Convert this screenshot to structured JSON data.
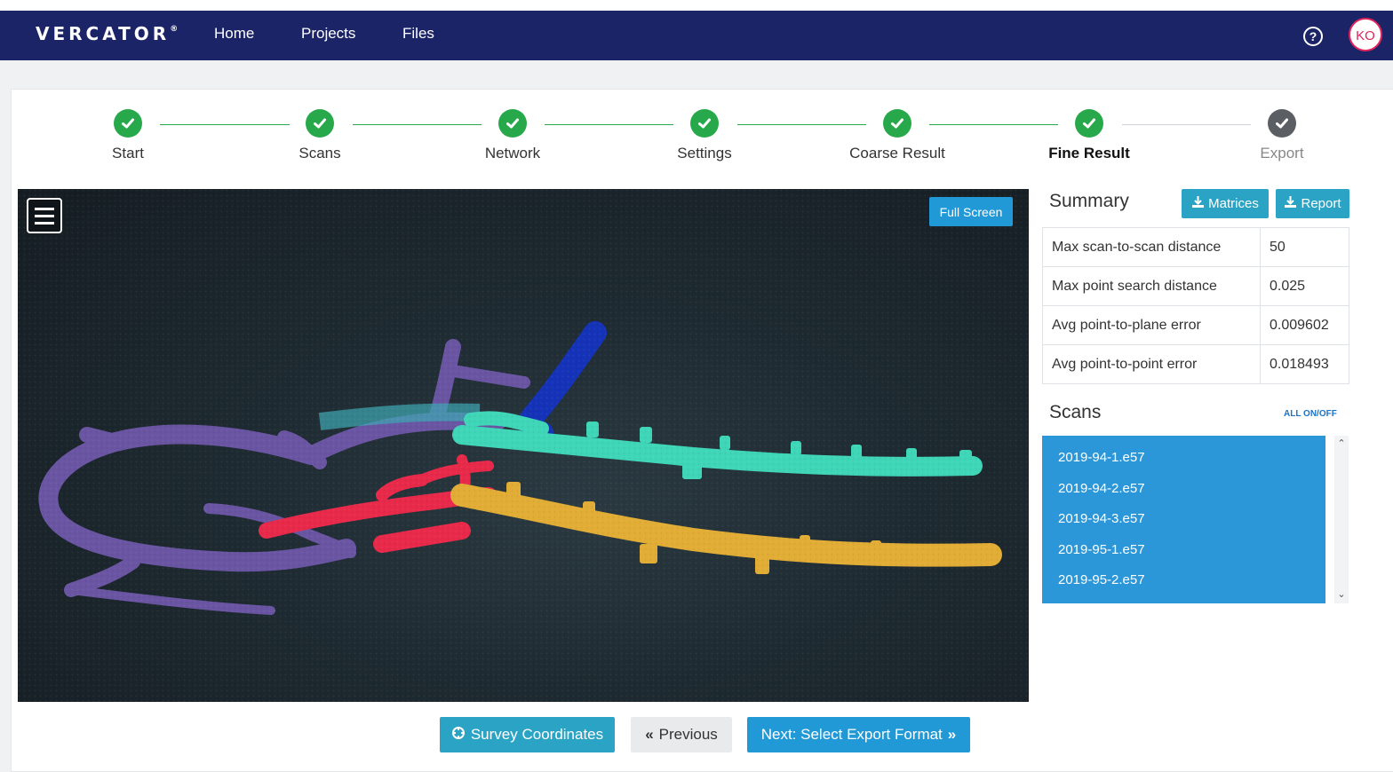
{
  "brand": {
    "name": "VERCATOR",
    "mark": "®"
  },
  "nav": {
    "home": "Home",
    "projects": "Projects",
    "files": "Files",
    "help_glyph": "?",
    "avatar_initials": "KO"
  },
  "steps": [
    {
      "label": "Start",
      "state": "done"
    },
    {
      "label": "Scans",
      "state": "done"
    },
    {
      "label": "Network",
      "state": "done"
    },
    {
      "label": "Settings",
      "state": "done"
    },
    {
      "label": "Coarse Result",
      "state": "done"
    },
    {
      "label": "Fine Result",
      "state": "active"
    },
    {
      "label": "Export",
      "state": "pending"
    }
  ],
  "viewer": {
    "fullscreen_label": "Full Screen"
  },
  "summary": {
    "title": "Summary",
    "matrices_label": "Matrices",
    "report_label": "Report",
    "rows": [
      {
        "label": "Max scan-to-scan distance",
        "value": "50"
      },
      {
        "label": "Max point search distance",
        "value": "0.025"
      },
      {
        "label": "Avg point-to-plane error",
        "value": "0.009602"
      },
      {
        "label": "Avg point-to-point error",
        "value": "0.018493"
      }
    ]
  },
  "scans": {
    "title": "Scans",
    "toggle_all": "ALL ON/OFF",
    "items": [
      "2019-94-1.e57",
      "2019-94-2.e57",
      "2019-94-3.e57",
      "2019-95-1.e57",
      "2019-95-2.e57"
    ]
  },
  "footer": {
    "survey_label": "Survey Coordinates",
    "previous_label": "Previous",
    "next_label": "Next: Select Export Format"
  },
  "colors": {
    "navbar": "#1b2466",
    "step_done": "#27a84a",
    "step_pending": "#5b5e63",
    "accent_blue": "#2199d6",
    "teal": "#2ba3c4",
    "scan_purple": "#6a55a3",
    "scan_teal": "#3fd6b8",
    "scan_blue": "#1533b8",
    "scan_red": "#e8294a",
    "scan_yellow": "#e2ad35"
  }
}
